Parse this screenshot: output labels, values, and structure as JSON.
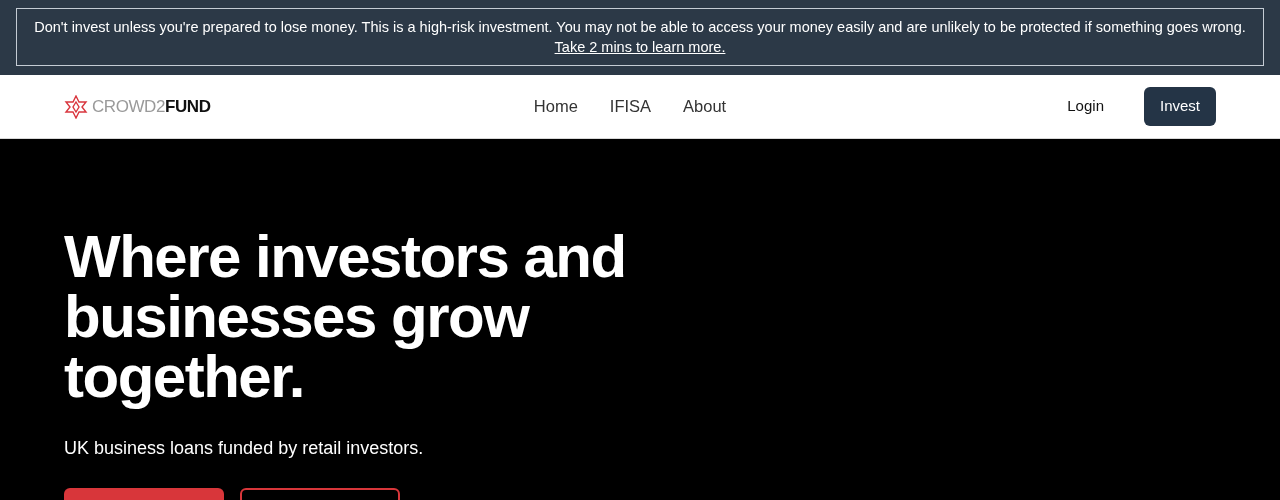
{
  "risk_banner": {
    "text": "Don't invest unless you're prepared to lose money. This is a high-risk investment. You may not be able to access your money easily and are unlikely to be protected if something goes wrong.",
    "link": "Take 2 mins to learn more."
  },
  "nav": {
    "logo": "CROWD2**FUND**",
    "links": [
      {
        "label": "Home"
      },
      {
        "label": "IFISA"
      },
      {
        "label": "About"
      }
    ],
    "actions": [
      {
        "label": "Login",
        "kind": "link"
      },
      {
        "label": "Invest",
        "kind": "primary"
      }
    ]
  },
  "hero": {
    "title": "Where investors and businesses grow together.",
    "subtitle": "UK business loans funded by retail investors.",
    "buttons": [
      {
        "kind": "primary"
      },
      {
        "kind": "outline"
      }
    ]
  }
}
